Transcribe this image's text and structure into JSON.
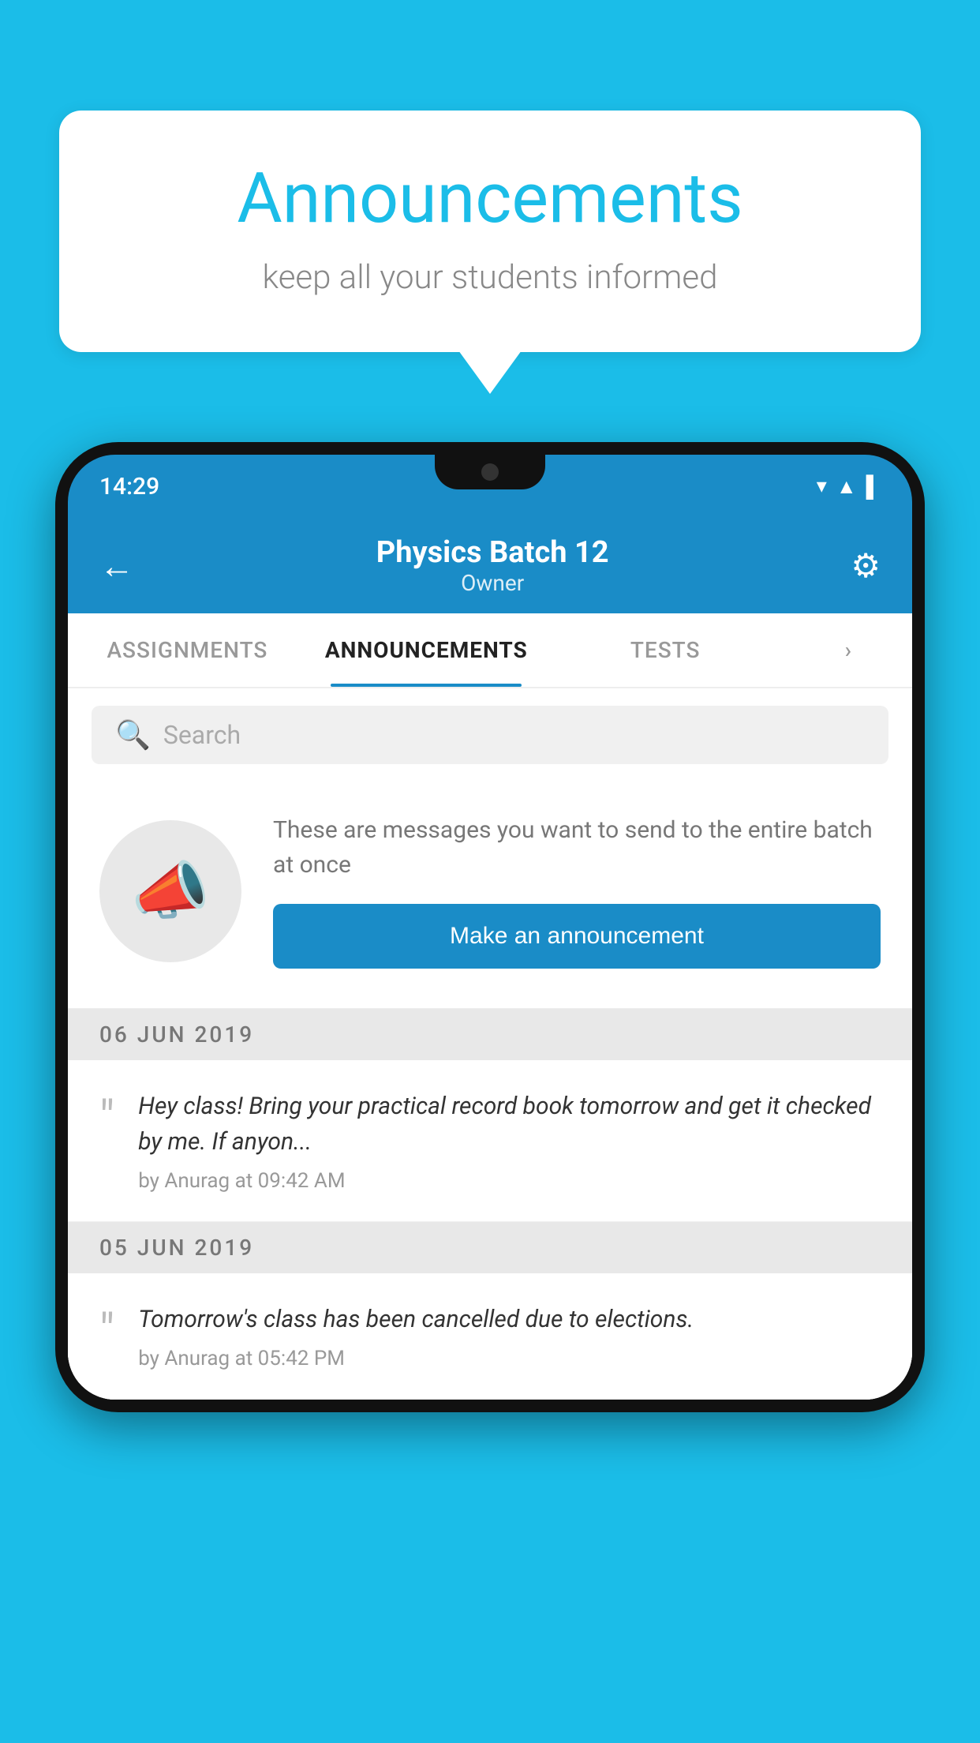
{
  "bubble": {
    "title": "Announcements",
    "subtitle": "keep all your students informed"
  },
  "status_bar": {
    "time": "14:29",
    "icons": [
      "▾",
      "▲",
      "▌"
    ]
  },
  "header": {
    "back_label": "←",
    "title": "Physics Batch 12",
    "subtitle": "Owner",
    "settings_label": "⚙"
  },
  "tabs": [
    {
      "label": "ASSIGNMENTS",
      "active": false
    },
    {
      "label": "ANNOUNCEMENTS",
      "active": true
    },
    {
      "label": "TESTS",
      "active": false
    },
    {
      "label": "›",
      "active": false
    }
  ],
  "search": {
    "placeholder": "Search"
  },
  "announcement_prompt": {
    "icon": "📣",
    "description": "These are messages you want to send to the entire batch at once",
    "button_label": "Make an announcement"
  },
  "date_sections": [
    {
      "date": "06  JUN  2019",
      "items": [
        {
          "message": "Hey class! Bring your practical record book tomorrow and get it checked by me. If anyon...",
          "meta": "by Anurag at 09:42 AM"
        }
      ]
    },
    {
      "date": "05  JUN  2019",
      "items": [
        {
          "message": "Tomorrow's class has been cancelled due to elections.",
          "meta": "by Anurag at 05:42 PM"
        }
      ]
    }
  ]
}
